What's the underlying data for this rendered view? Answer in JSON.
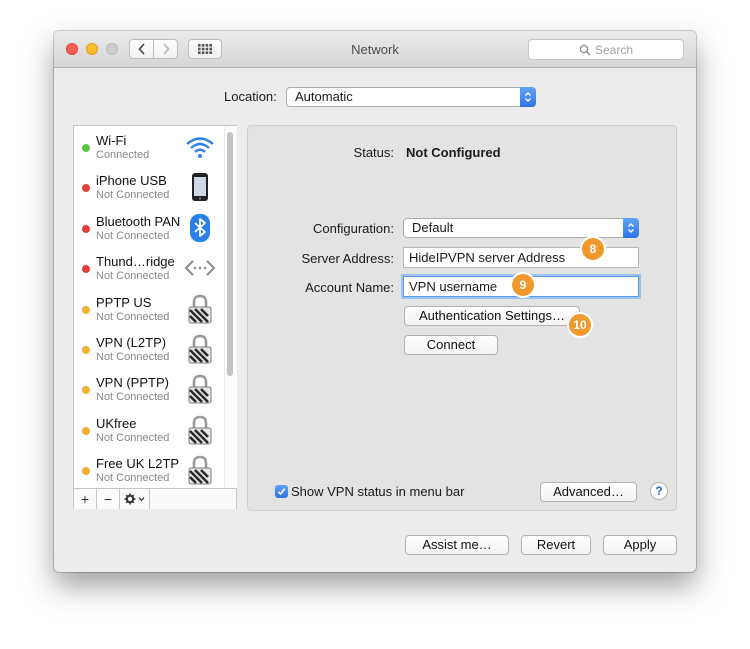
{
  "window": {
    "title": "Network",
    "search_placeholder": "Search"
  },
  "location": {
    "label": "Location:",
    "value": "Automatic"
  },
  "services": [
    {
      "name": "Wi-Fi",
      "status": "Connected",
      "dot_color": "#5ac946",
      "icon": "wifi-icon"
    },
    {
      "name": "iPhone USB",
      "status": "Not Connected",
      "dot_color": "#e0413a",
      "icon": "iphone-icon"
    },
    {
      "name": "Bluetooth PAN",
      "status": "Not Connected",
      "dot_color": "#e0413a",
      "icon": "bluetooth-icon"
    },
    {
      "name": "Thund…ridge",
      "status": "Not Connected",
      "dot_color": "#e0413a",
      "icon": "thunderbolt-bridge-icon"
    },
    {
      "name": "PPTP US",
      "status": "Not Connected",
      "dot_color": "#f2b02e",
      "icon": "vpn-lock-icon"
    },
    {
      "name": "VPN (L2TP)",
      "status": "Not Connected",
      "dot_color": "#f2b02e",
      "icon": "vpn-lock-icon"
    },
    {
      "name": "VPN (PPTP)",
      "status": "Not Connected",
      "dot_color": "#f2b02e",
      "icon": "vpn-lock-icon"
    },
    {
      "name": "UKfree",
      "status": "Not Connected",
      "dot_color": "#f2b02e",
      "icon": "vpn-lock-icon"
    },
    {
      "name": "Free UK L2TP",
      "status": "Not Connected",
      "dot_color": "#f2b02e",
      "icon": "vpn-lock-icon"
    }
  ],
  "sidebar_actions": {
    "add": "+",
    "remove": "−"
  },
  "detail": {
    "status_label": "Status:",
    "status_value": "Not Configured",
    "configuration_label": "Configuration:",
    "configuration_value": "Default",
    "server_label": "Server Address:",
    "server_value": "HideIPVPN server Address",
    "account_label": "Account Name:",
    "account_value": "VPN username",
    "auth_button": "Authentication Settings…",
    "connect_button": "Connect",
    "show_vpn_label": "Show VPN status in menu bar",
    "show_vpn_checked": true,
    "advanced_button": "Advanced…",
    "help_glyph": "?"
  },
  "badges": {
    "server": "8",
    "account": "9",
    "auth": "10"
  },
  "footer": {
    "assist": "Assist me…",
    "revert": "Revert",
    "apply": "Apply"
  },
  "colors": {
    "accent": "#2d74e6",
    "badge": "#f0982b"
  }
}
